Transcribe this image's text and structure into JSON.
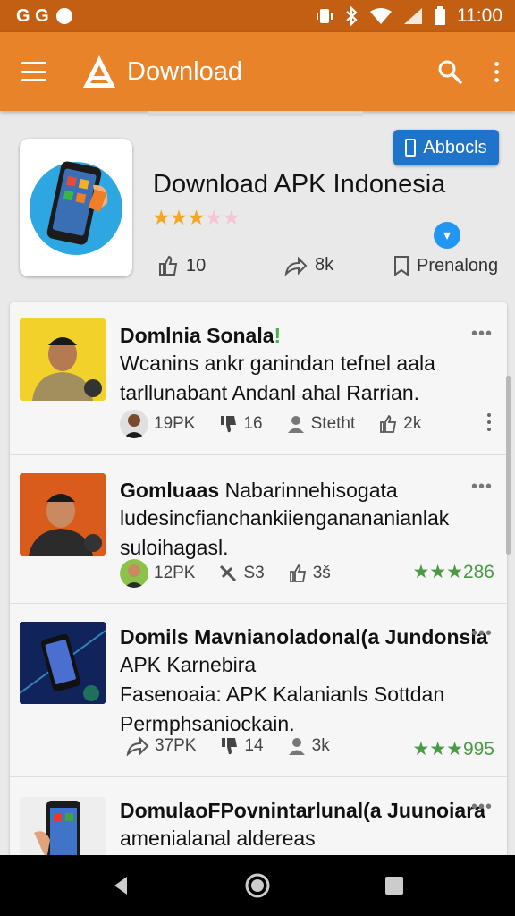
{
  "status_bar": {
    "left_text": "G G",
    "time": "11:00",
    "icons": [
      "notification-dot-icon",
      "vibrate-icon",
      "bluetooth-icon",
      "wifi-icon",
      "signal-icon",
      "battery-icon"
    ]
  },
  "app_bar": {
    "title": "Download",
    "icons": [
      "menu-icon",
      "app-logo-icon",
      "search-icon",
      "more-vert-icon"
    ]
  },
  "header": {
    "about_button": "Abbocls",
    "title": "Download APK Indonesia",
    "rating_stars_filled": 3,
    "rating_stars_total": 5,
    "stats": [
      {
        "icon": "thumbs-up-icon",
        "value": "10"
      },
      {
        "icon": "share-icon",
        "value": "8k"
      },
      {
        "icon": "bookmark-icon",
        "value": "Prenalong"
      }
    ]
  },
  "feed": {
    "posts": [
      {
        "title": "Domlnia Sonala",
        "title_mark": "!",
        "lines": [
          "Wcanins ankr ganindan tefnel aala",
          "tarllunabant  Andanl ahal Rarrian."
        ],
        "more": "•••",
        "meta": [
          {
            "icon": "avatar",
            "value": "19PK"
          },
          {
            "icon": "thumbs-down-icon",
            "value": "16"
          },
          {
            "icon": "person-icon",
            "value": "Stetht"
          },
          {
            "icon": "thumbs-up-icon",
            "value": "2k"
          }
        ],
        "rating": ""
      },
      {
        "title": "Gomluaas",
        "title_rest": " Nabarinnehisogata",
        "lines": [
          "ludesincfianchankiienganananianlak",
          "suloihagasl."
        ],
        "more": "•••",
        "meta": [
          {
            "icon": "avatar",
            "value": "12PK"
          },
          {
            "icon": "tools-icon",
            "value": "S3"
          },
          {
            "icon": "thumbs-up-icon",
            "value": "3š"
          }
        ],
        "rating": "★★★286"
      },
      {
        "title": "Domils Mavnianoladonal(a Jundonsla",
        "lines": [
          "APK Karnebira",
          "Fasenoaia: APK Kalanianls Sottdan",
          "Permphsaniockain."
        ],
        "more": "•••",
        "meta": [
          {
            "icon": "share-icon",
            "value": "37PK"
          },
          {
            "icon": "thumbs-down-icon",
            "value": "14"
          },
          {
            "icon": "person-icon",
            "value": "3k"
          }
        ],
        "rating": "★★★995"
      },
      {
        "title": "DomulaoFPovnintarlunal(a Juunoiara",
        "lines": [
          "amenialanal alderеas"
        ],
        "more": "•••",
        "meta": [],
        "rating": ""
      }
    ]
  },
  "nav_bar": {
    "icons": [
      "back-icon",
      "home-icon",
      "recents-icon"
    ]
  },
  "colors": {
    "status_bar": "#c35f12",
    "app_bar": "#e8832a",
    "accent_blue": "#1f73c9",
    "rating_green": "#4a9a45",
    "star": "#f5a623"
  }
}
